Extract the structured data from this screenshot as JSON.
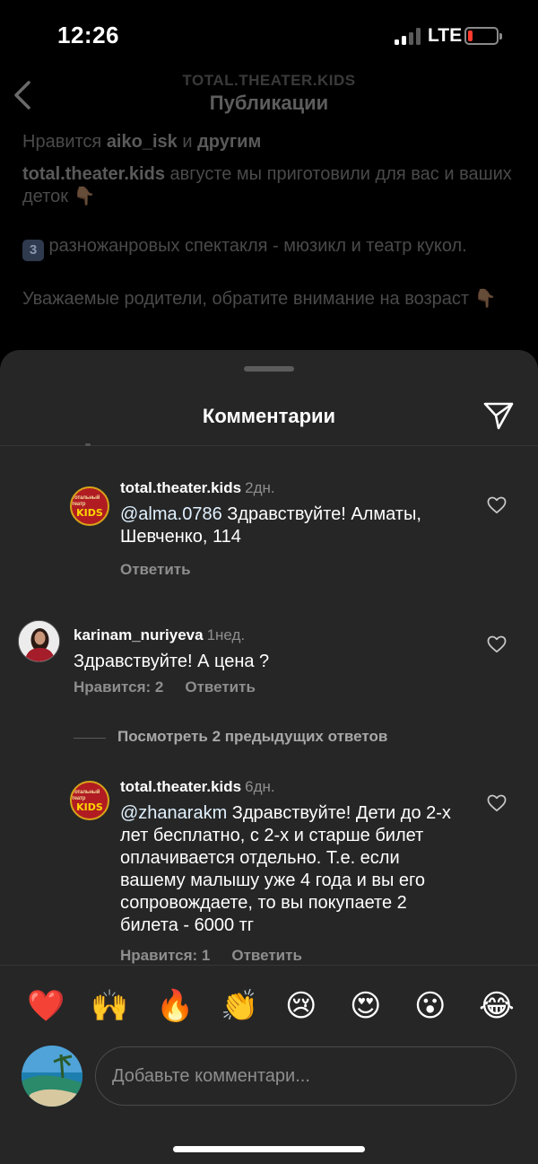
{
  "status_bar": {
    "time": "12:26",
    "network": "LTE",
    "battery_level": 0.15
  },
  "header": {
    "account": "TOTAL.THEATER.KIDS",
    "title": "Публикации"
  },
  "post": {
    "likes_prefix": "Нравится ",
    "likes_user": "aiko_isk",
    "likes_mid": " и ",
    "likes_others": "другим",
    "author": "total.theater.kids",
    "caption_1": " августе мы приготовили для вас и ваших деток ",
    "badge_number": "3",
    "caption_2": " разножанровых спектакля - мюзикл и театр кукол.",
    "caption_3": "Уважаемые родители, обратите внимание на возраст ",
    "point_emoji": "👇🏽"
  },
  "sheet": {
    "title": "Комментарии"
  },
  "comments": [
    {
      "user": "total.theater.kids",
      "time": "2дн.",
      "mention": "@alma.0786",
      "text": " Здравствуйте! Алматы, Шевченко, 114",
      "reply_label": "Ответить",
      "avatar_top": "Тотальный театр",
      "avatar_kids": "KIDS"
    },
    {
      "user": "karinam_nuriyeva",
      "time": "1нед.",
      "text": "Здравствуйте! А цена ?",
      "likes_label": "Нравится: 2",
      "reply_label": "Ответить"
    },
    {
      "user": "total.theater.kids",
      "time": "6дн.",
      "mention": "@zhanarakm",
      "text": " Здравствуйте! Дети до 2-х лет бесплатно, с 2-х и старше билет оплачивается отдельно. Т.е. если вашему малышу уже 4 года и вы его сопровождаете, то вы покупаете 2 билета - 6000 тг",
      "likes_label": "Нравится: 1",
      "reply_label": "Ответить",
      "avatar_top": "Тотальный театр",
      "avatar_kids": "KIDS"
    }
  ],
  "view_replies": "Посмотреть 2 предыдущих ответов",
  "emoji_bar": [
    "❤️",
    "🙌",
    "🔥",
    "👏",
    "😢",
    "😍",
    "😮",
    "😂"
  ],
  "input": {
    "placeholder": "Добавьте комментари..."
  },
  "icons": {
    "back": "chevron-left-icon",
    "share": "paper-plane-icon",
    "like": "heart-outline-icon"
  },
  "colors": {
    "background": "#000000",
    "sheet": "#262626",
    "secondary_text": "#8e8e8e",
    "battery_low": "#ff3b30"
  }
}
